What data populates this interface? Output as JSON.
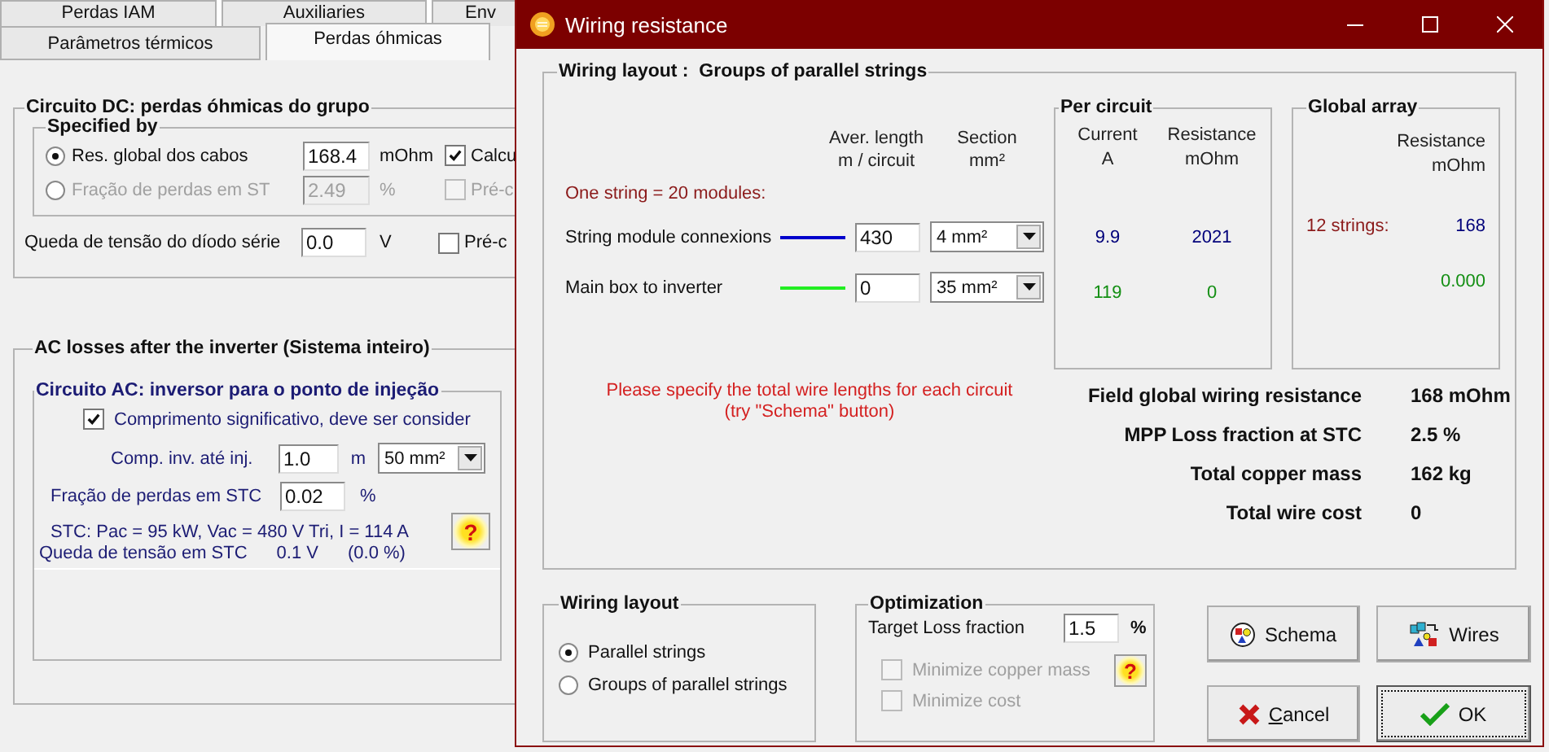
{
  "background": {
    "tab_rows": [
      [
        {
          "label": "Perdas IAM",
          "selected": false
        },
        {
          "label": "Auxiliaries",
          "selected": false
        },
        {
          "label": "Env",
          "selected": false
        }
      ],
      [
        {
          "label": "Parâmetros térmicos",
          "selected": false
        },
        {
          "label": "Perdas óhmicas",
          "selected": true
        }
      ]
    ],
    "dc_group": {
      "title": "Circuito DC: perdas óhmicas do grupo",
      "specified_by": {
        "title": "Specified by",
        "options": [
          {
            "label": "Res. global dos cabos",
            "selected": true,
            "value": "168.4",
            "unit": "mOhm",
            "disabled": false,
            "check_label": "Calcu",
            "checked": true
          },
          {
            "label": "Fração de perdas em ST",
            "selected": false,
            "value": "2.49",
            "unit": "%",
            "disabled": true,
            "check_label": "Pré-c",
            "checked": false
          }
        ]
      },
      "diode": {
        "label": "Queda de tensão do díodo série",
        "value": "0.0",
        "unit": "V",
        "check_label": "Pré-c",
        "checked": false
      }
    },
    "ac_group": {
      "title": "AC losses after the inverter  (Sistema inteiro)",
      "circuit": {
        "title": "Circuito AC: inversor para o ponto de injeção",
        "significant": {
          "label": "Comprimento significativo, deve ser consider",
          "checked": true
        },
        "length": {
          "label": "Comp. inv. até inj.",
          "value": "1.0",
          "unit": "m",
          "section": "50 mm²"
        },
        "loss_fraction": {
          "label": "Fração de perdas em STC",
          "value": "0.02",
          "unit": "%"
        },
        "stc_info": "STC: Pac = 95 kW, Vac = 480 V Tri, I = 114 A",
        "help": "?",
        "voltage_drop": {
          "label": "Queda de tensão em STC",
          "value": "0.1 V",
          "percent": "(0.0 %)"
        }
      }
    }
  },
  "dialog": {
    "title": "Wiring resistance",
    "layout_group": {
      "label": "Wiring layout :",
      "value": "Groups of parallel strings",
      "headers": [
        {
          "line1": "Aver. length",
          "line2": "m / circuit"
        },
        {
          "line1": "Section",
          "line2": "mm²"
        }
      ],
      "string_note": "One string = 20 modules:",
      "circuits": [
        {
          "name": "String module connexions",
          "color": "#0000cc",
          "length": "430",
          "section": "4 mm²",
          "current": "9.9",
          "resistance": "2021",
          "global_label": "12 strings:",
          "global_resistance": "168"
        },
        {
          "name": "Main box to inverter",
          "color": "#22ee22",
          "length": "0",
          "section": "35 mm²",
          "current": "119",
          "resistance": "0",
          "global_resistance": "0.000"
        }
      ],
      "warning": [
        "Please specify the total wire lengths for each circuit",
        "(try  \"Schema\" button)"
      ],
      "per_circuit": {
        "title": "Per circuit",
        "headers": [
          {
            "line1": "Current",
            "line2": "A"
          },
          {
            "line1": "Resistance",
            "line2": "mOhm"
          }
        ]
      },
      "global_array": {
        "title": "Global array",
        "header": {
          "line1": "Resistance",
          "line2": "mOhm"
        }
      },
      "summary": [
        {
          "label": "Field global wiring resistance",
          "value": "168 mOhm"
        },
        {
          "label": "MPP Loss fraction at  STC",
          "value": "2.5 %"
        },
        {
          "label": "Total copper mass",
          "value": "162 kg"
        },
        {
          "label": "Total wire cost",
          "value": "0"
        }
      ]
    },
    "wiring_layout": {
      "title": "Wiring layout",
      "options": [
        {
          "label": "Parallel strings",
          "selected": true
        },
        {
          "label": "Groups of parallel strings",
          "selected": false
        }
      ]
    },
    "optimization": {
      "title": "Optimization",
      "target": {
        "label": "Target Loss fraction",
        "value": "1.5",
        "unit": "%"
      },
      "options": [
        {
          "label": "Minimize copper mass",
          "checked": false,
          "disabled": true
        },
        {
          "label": "Minimize cost",
          "checked": false,
          "disabled": true
        }
      ],
      "help": "?"
    },
    "buttons": [
      {
        "label": "Schema",
        "kind": "schema",
        "focused": false
      },
      {
        "label": "Wires",
        "kind": "wires",
        "focused": false
      },
      {
        "label": "Cancel",
        "kind": "cancel",
        "focused": false
      },
      {
        "label": "OK",
        "kind": "ok",
        "focused": true
      }
    ]
  }
}
